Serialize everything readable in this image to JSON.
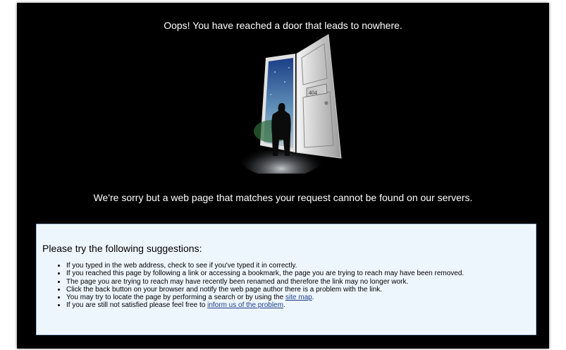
{
  "header": {
    "headline": "Oops! You have reached a door that leads to nowhere.",
    "door_sign": "404"
  },
  "message": {
    "sorry": "We're sorry but a web page that matches your request cannot be found on our servers."
  },
  "suggestions": {
    "title": "Please try the following suggestions:",
    "items": [
      "If you typed in the web address, check to see if you've typed it in correctly.",
      "If you reached this page by following a link or accessing a bookmark, the page you are trying to reach may have been removed.",
      "The page you are trying to reach may have recently been renamed and therefore the link may no longer work.",
      "Click the back button on your browser and notify the web page author there is a problem with the link."
    ],
    "sitemap_prefix": "You may try to locate the page by performing a search or by using the ",
    "sitemap_link": "site map",
    "sitemap_suffix": ".",
    "inform_prefix": "If you are still not satisfied please feel free to ",
    "inform_link": "inform us of the problem",
    "inform_suffix": "."
  },
  "colors": {
    "background": "#000000",
    "text": "#ffffff",
    "box_bg": "#eef6fd",
    "box_border": "#8eb6da",
    "link": "#1a3e8a"
  }
}
